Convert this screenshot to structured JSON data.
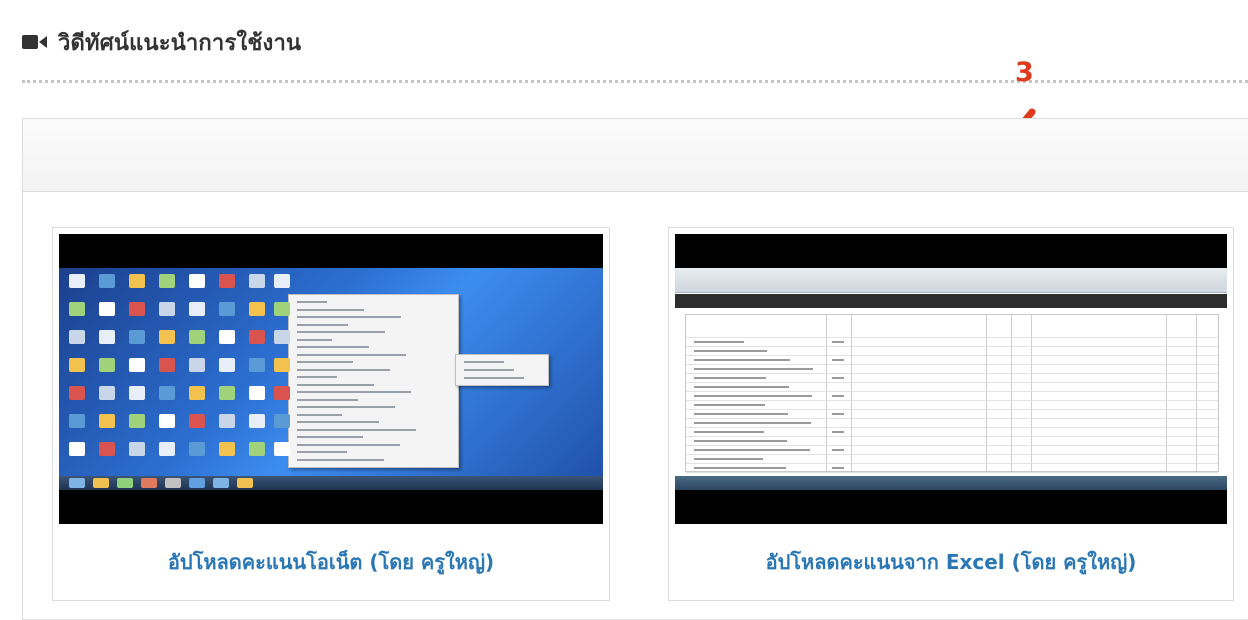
{
  "section": {
    "icon": "video-camera-icon",
    "title": "วิดีทัศน์แนะนำการใช้งาน"
  },
  "annotation": {
    "number": "3",
    "color": "#e0391d",
    "arrow_icon": "red-arrow-icon"
  },
  "videos": [
    {
      "caption": "อัปโหลดคะแนนโอเน็ต (โดย ครูใหญ่)",
      "thumbnail": "windows-desktop-context-menu-screenshot"
    },
    {
      "caption": "อัปโหลดคะแนนจาก Excel (โดย ครูใหญ่)",
      "thumbnail": "spreadsheet-web-form-screenshot"
    }
  ],
  "colors": {
    "link": "#2a77b5",
    "title": "#333333",
    "border": "#dddddd"
  }
}
